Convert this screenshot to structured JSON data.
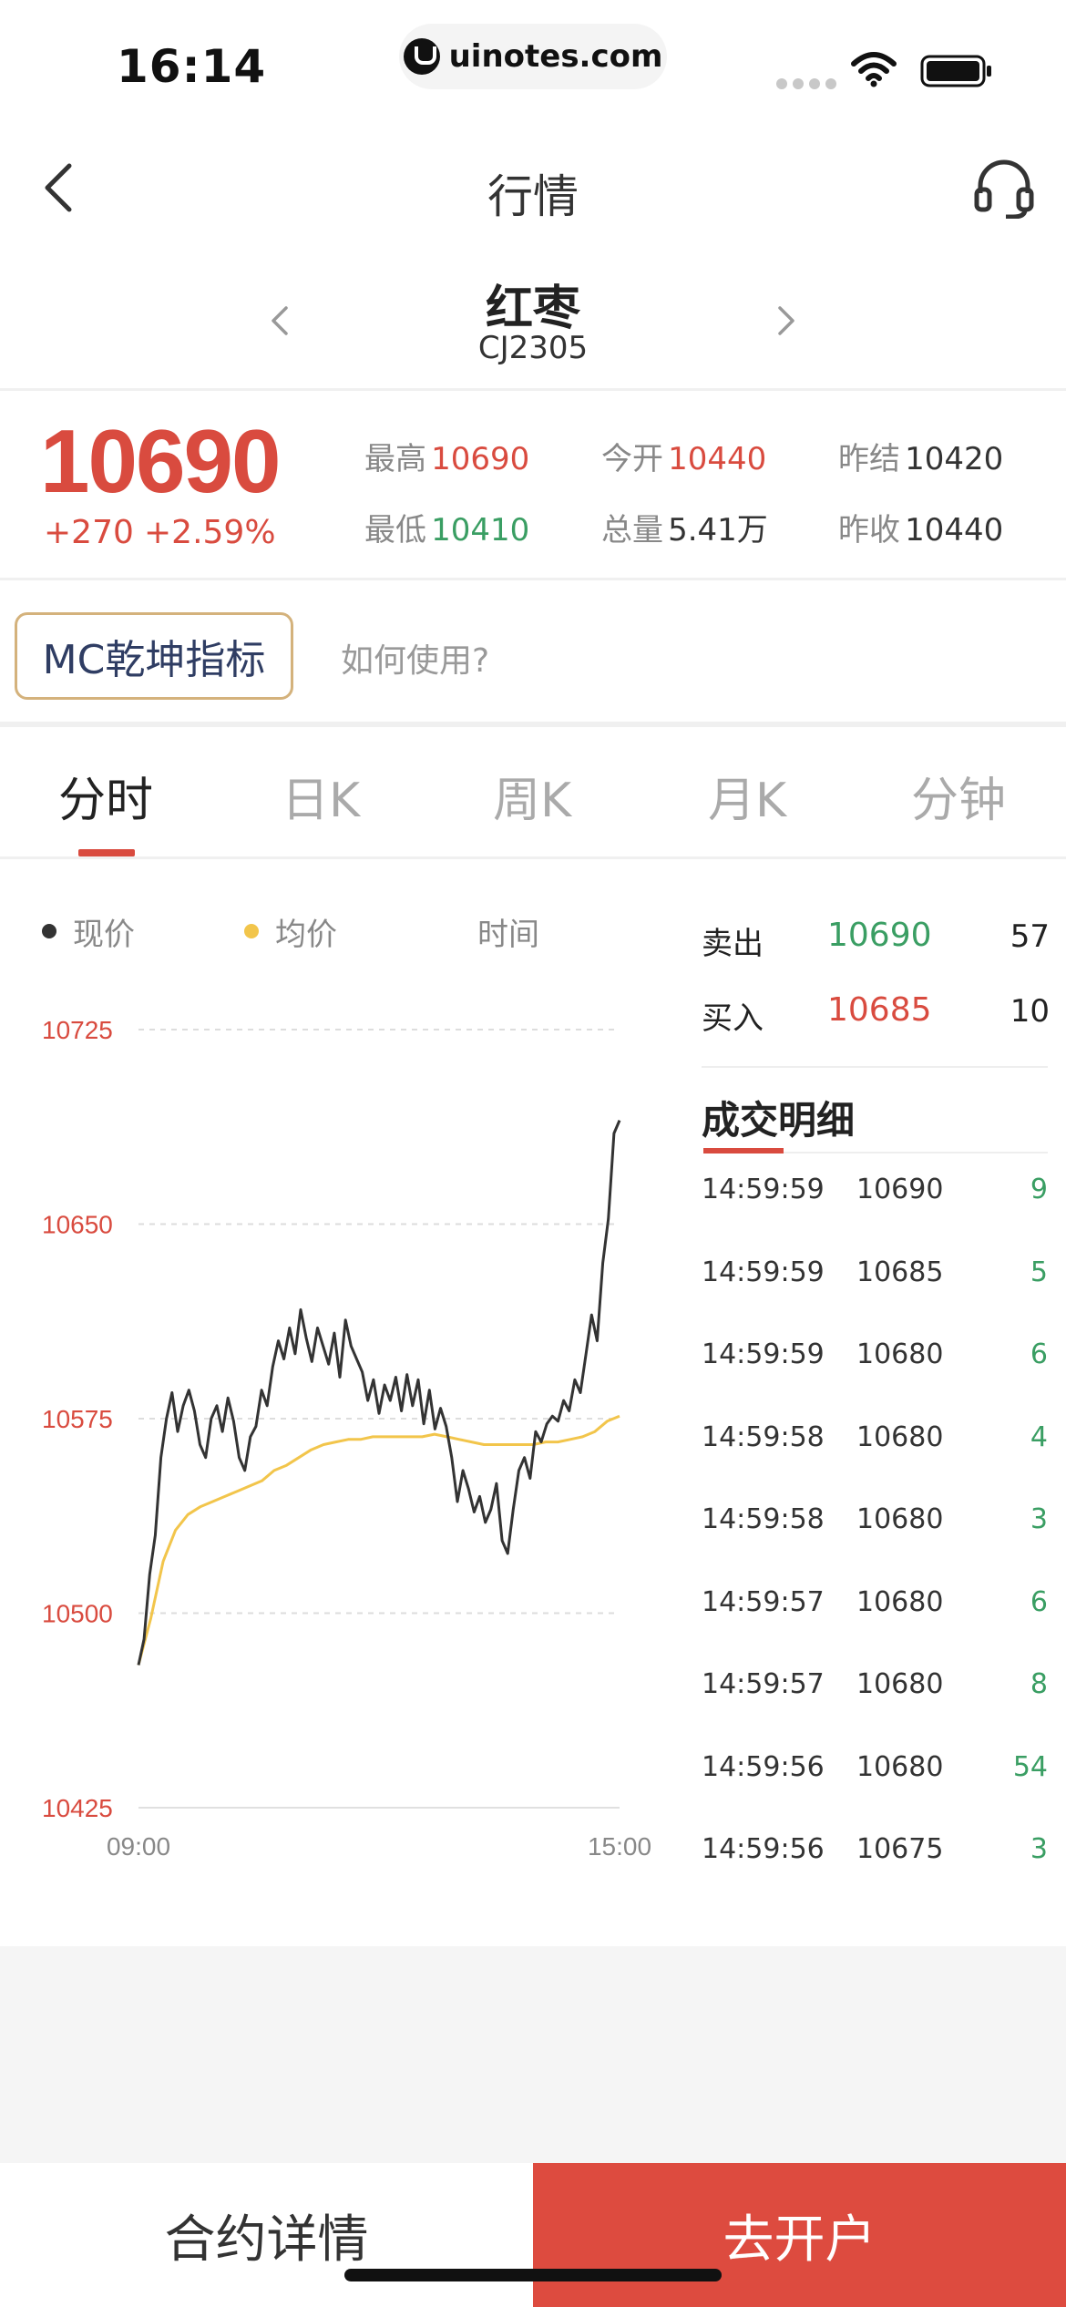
{
  "status_bar": {
    "time": "16:14",
    "url": "uinotes.com"
  },
  "nav": {
    "title": "行情"
  },
  "contract": {
    "name": "红枣",
    "code": "CJ2305"
  },
  "quote": {
    "last": "10690",
    "change": "+270",
    "change_pct": "+2.59%",
    "high_label": "最高",
    "high": "10690",
    "open_label": "今开",
    "open": "10440",
    "prev_settle_label": "昨结",
    "prev_settle": "10420",
    "low_label": "最低",
    "low": "10410",
    "volume_label": "总量",
    "volume": "5.41万",
    "prev_close_label": "昨收",
    "prev_close": "10440"
  },
  "indicator": {
    "badge": "MC乾坤指标",
    "howto": "如何使用?"
  },
  "tabs": [
    "分时",
    "日K",
    "周K",
    "月K",
    "分钟"
  ],
  "legend": {
    "price": "现价",
    "avg": "均价",
    "time": "时间"
  },
  "order_book": {
    "sell_label": "卖出",
    "sell_price": "10690",
    "sell_vol": "57",
    "buy_label": "买入",
    "buy_price": "10685",
    "buy_vol": "10"
  },
  "trades": {
    "title": "成交明细",
    "rows": [
      {
        "time": "14:59:59",
        "price": "10690",
        "vol": "9"
      },
      {
        "time": "14:59:59",
        "price": "10685",
        "vol": "5"
      },
      {
        "time": "14:59:59",
        "price": "10680",
        "vol": "6"
      },
      {
        "time": "14:59:58",
        "price": "10680",
        "vol": "4"
      },
      {
        "time": "14:59:58",
        "price": "10680",
        "vol": "3"
      },
      {
        "time": "14:59:57",
        "price": "10680",
        "vol": "6"
      },
      {
        "time": "14:59:57",
        "price": "10680",
        "vol": "8"
      },
      {
        "time": "14:59:56",
        "price": "10680",
        "vol": "54"
      },
      {
        "time": "14:59:56",
        "price": "10675",
        "vol": "3"
      }
    ]
  },
  "buttons": {
    "detail": "合约详情",
    "open_account": "去开户"
  },
  "colors": {
    "up": "#d94b3f",
    "down": "#3a9e63",
    "avg_line": "#f2c54b",
    "price_line": "#333333",
    "accent_button": "#dd4b3f"
  },
  "chart_data": {
    "type": "line",
    "ylim": [
      10425,
      10725
    ],
    "yticks": [
      "10725",
      "10650",
      "10575",
      "10500",
      "10425"
    ],
    "x_start": "09:00",
    "x_end": "15:00",
    "series": [
      {
        "name": "现价",
        "values": [
          10480,
          10490,
          10515,
          10530,
          10560,
          10575,
          10585,
          10570,
          10580,
          10586,
          10578,
          10565,
          10560,
          10575,
          10580,
          10570,
          10583,
          10574,
          10560,
          10555,
          10568,
          10572,
          10586,
          10580,
          10595,
          10605,
          10598,
          10610,
          10600,
          10617,
          10606,
          10597,
          10610,
          10603,
          10596,
          10608,
          10591,
          10613,
          10603,
          10598,
          10593,
          10582,
          10590,
          10577,
          10588,
          10582,
          10591,
          10578,
          10592,
          10580,
          10590,
          10573,
          10586,
          10571,
          10579,
          10572,
          10560,
          10543,
          10555,
          10548,
          10539,
          10545,
          10535,
          10540,
          10550,
          10528,
          10523,
          10540,
          10555,
          10560,
          10552,
          10570,
          10566,
          10573,
          10576,
          10574,
          10582,
          10578,
          10590,
          10585,
          10600,
          10615,
          10605,
          10635,
          10652,
          10685,
          10690
        ]
      },
      {
        "name": "均价",
        "values": [
          10480,
          10498,
          10520,
          10532,
          10538,
          10541,
          10543,
          10545,
          10547,
          10549,
          10551,
          10555,
          10557,
          10560,
          10563,
          10565,
          10566,
          10567,
          10567,
          10568,
          10568,
          10568,
          10568,
          10568,
          10569,
          10568,
          10567,
          10566,
          10565,
          10565,
          10565,
          10565,
          10565,
          10566,
          10566,
          10567,
          10568,
          10570,
          10574,
          10576
        ]
      }
    ]
  }
}
